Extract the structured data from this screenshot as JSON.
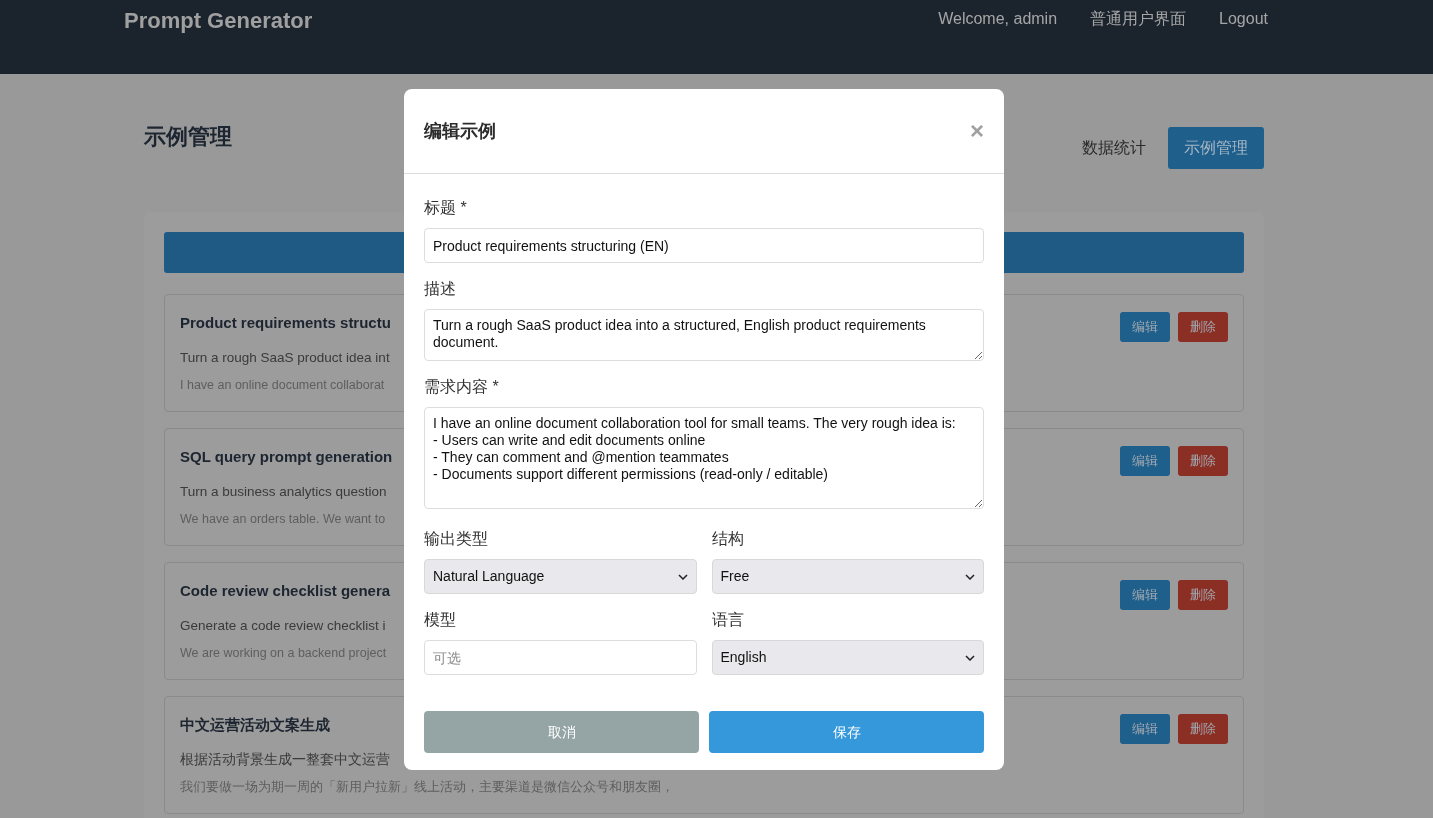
{
  "header": {
    "brand": "Prompt Generator",
    "welcome": "Welcome, admin",
    "links": [
      "普通用户界面",
      "Logout"
    ]
  },
  "page": {
    "title": "示例管理",
    "tabs": [
      {
        "label": "数据统计",
        "selected": false
      },
      {
        "label": "示例管理",
        "selected": true
      }
    ]
  },
  "examples": [
    {
      "title": "Product requirements structu",
      "description": "Turn a rough SaaS product idea int",
      "content": "I have an online document collaborat",
      "actions": [
        {
          "label": "编辑",
          "kind": "edit"
        },
        {
          "label": "删除",
          "kind": "delete"
        }
      ]
    },
    {
      "title": "SQL query prompt generation",
      "description": "Turn a business analytics question",
      "content": "We have an orders table. We want to",
      "actions": [
        {
          "label": "编辑",
          "kind": "edit"
        },
        {
          "label": "删除",
          "kind": "delete"
        }
      ]
    },
    {
      "title": "Code review checklist genera",
      "description": "Generate a code review checklist i",
      "content": "We are working on a backend project",
      "actions": [
        {
          "label": "编辑",
          "kind": "edit"
        },
        {
          "label": "删除",
          "kind": "delete"
        }
      ]
    },
    {
      "title": "中文运营活动文案生成",
      "description": "根据活动背景生成一整套中文运营",
      "content": "我们要做一场为期一周的「新用户拉新」线上活动，主要渠道是微信公众号和朋友圈，",
      "actions": [
        {
          "label": "编辑",
          "kind": "edit"
        },
        {
          "label": "删除",
          "kind": "delete"
        }
      ]
    }
  ],
  "modal": {
    "title": "编辑示例",
    "close": "×",
    "fields": [
      {
        "label": "标题 *",
        "kind": "input",
        "value": "Product requirements structuring (EN)"
      },
      {
        "label": "描述",
        "kind": "textarea",
        "value": "Turn a rough SaaS product idea into a structured, English product requirements document."
      },
      {
        "label": "需求内容 *",
        "kind": "textarea",
        "value": "I have an online document collaboration tool for small teams. The very rough idea is:\n- Users can write and edit documents online\n- They can comment and @mention teammates\n- Documents support different permissions (read-only / editable)"
      }
    ],
    "option_fields": [
      {
        "label": "输出类型",
        "kind": "select",
        "value": "Natural Language"
      },
      {
        "label": "结构",
        "kind": "select",
        "value": "Free"
      },
      {
        "label": "模型",
        "kind": "input",
        "placeholder": "可选"
      },
      {
        "label": "语言",
        "kind": "select",
        "value": "English"
      }
    ],
    "buttons": [
      {
        "label": "取消",
        "kind": "cancel"
      },
      {
        "label": "保存",
        "kind": "primary"
      }
    ]
  }
}
